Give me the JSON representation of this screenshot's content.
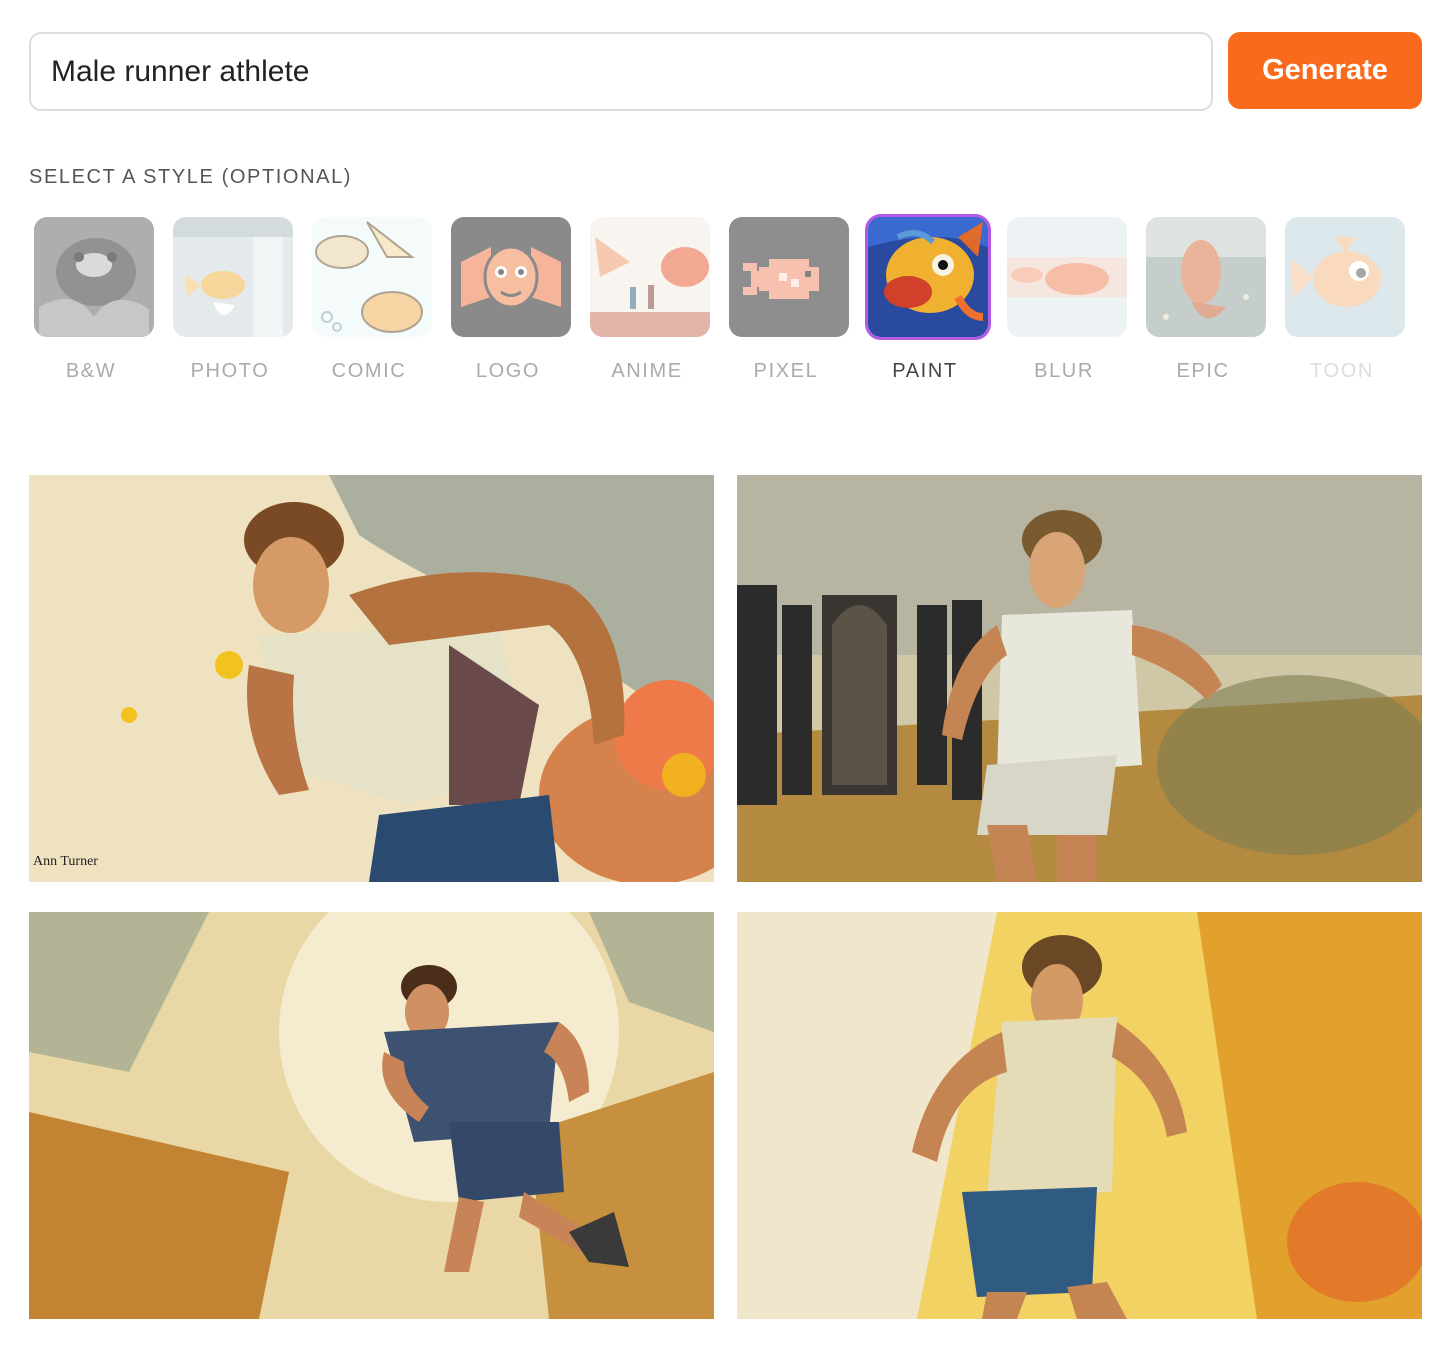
{
  "prompt": {
    "value": "Male runner athlete"
  },
  "generate_button": {
    "label": "Generate",
    "color": "#fa6a1d"
  },
  "style_section": {
    "heading": "SELECT A STYLE (OPTIONAL)",
    "selected": "PAINT",
    "selected_border_color": "#b45ae6",
    "styles": [
      {
        "label": "B&W",
        "icon": "bw-fish-thumbnail"
      },
      {
        "label": "PHOTO",
        "icon": "photo-fish-thumbnail"
      },
      {
        "label": "COMIC",
        "icon": "comic-fish-thumbnail"
      },
      {
        "label": "LOGO",
        "icon": "logo-fish-thumbnail"
      },
      {
        "label": "ANIME",
        "icon": "anime-fish-thumbnail"
      },
      {
        "label": "PIXEL",
        "icon": "pixel-fish-thumbnail"
      },
      {
        "label": "PAINT",
        "icon": "paint-fish-thumbnail"
      },
      {
        "label": "BLUR",
        "icon": "blur-fish-thumbnail"
      },
      {
        "label": "EPIC",
        "icon": "epic-fish-thumbnail"
      },
      {
        "label": "TOON",
        "icon": "toon-fish-thumbnail"
      }
    ]
  },
  "results": [
    {
      "name": "runner-painting-1",
      "signature": "Ann Turner"
    },
    {
      "name": "runner-painting-2"
    },
    {
      "name": "runner-painting-3"
    },
    {
      "name": "runner-painting-4"
    }
  ]
}
